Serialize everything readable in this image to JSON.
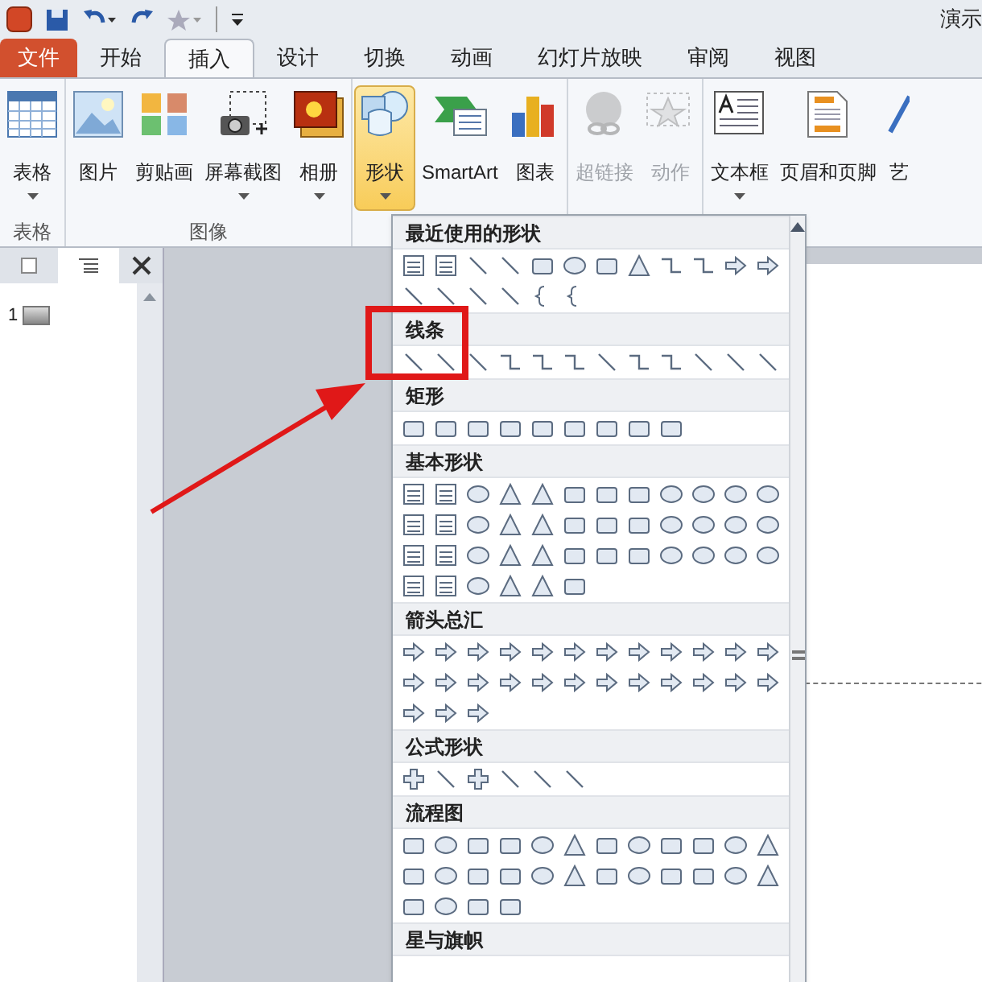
{
  "window": {
    "title": "演示"
  },
  "tabs": [
    {
      "label": "文件",
      "kind": "file",
      "selected": false
    },
    {
      "label": "开始",
      "kind": "tab",
      "selected": false
    },
    {
      "label": "插入",
      "kind": "tab",
      "selected": true
    },
    {
      "label": "设计",
      "kind": "tab",
      "selected": false
    },
    {
      "label": "切换",
      "kind": "tab",
      "selected": false
    },
    {
      "label": "动画",
      "kind": "tab",
      "selected": false
    },
    {
      "label": "幻灯片放映",
      "kind": "tab",
      "selected": false
    },
    {
      "label": "审阅",
      "kind": "tab",
      "selected": false
    },
    {
      "label": "视图",
      "kind": "tab",
      "selected": false
    }
  ],
  "ribbon_groups": [
    {
      "label": "表格",
      "buttons": [
        {
          "label": "表格",
          "dropdown": true,
          "disabled": false,
          "selected": false
        }
      ]
    },
    {
      "label": "图像",
      "buttons": [
        {
          "label": "图片",
          "dropdown": false,
          "disabled": false,
          "selected": false
        },
        {
          "label": "剪贴画",
          "dropdown": false,
          "disabled": false,
          "selected": false
        },
        {
          "label": "屏幕截图",
          "dropdown": true,
          "disabled": false,
          "selected": false
        },
        {
          "label": "相册",
          "dropdown": true,
          "disabled": false,
          "selected": false
        }
      ]
    },
    {
      "buttons": [
        {
          "label": "形状",
          "dropdown": true,
          "disabled": false,
          "selected": true
        },
        {
          "label": "SmartArt",
          "dropdown": false,
          "disabled": false,
          "selected": false
        },
        {
          "label": "图表",
          "dropdown": false,
          "disabled": false,
          "selected": false
        }
      ]
    },
    {
      "buttons": [
        {
          "label": "超链接",
          "dropdown": false,
          "disabled": true,
          "selected": false
        },
        {
          "label": "动作",
          "dropdown": false,
          "disabled": true,
          "selected": false
        }
      ]
    },
    {
      "buttons": [
        {
          "label": "文本框",
          "dropdown": true,
          "disabled": false,
          "selected": false
        },
        {
          "label": "页眉和页脚",
          "dropdown": false,
          "disabled": false,
          "selected": false
        },
        {
          "label": "艺",
          "dropdown": false,
          "disabled": false,
          "selected": false
        }
      ]
    }
  ],
  "slide_pane": {
    "slides": [
      {
        "number": "1"
      }
    ]
  },
  "shapes_menu": {
    "sections": [
      {
        "title": "最近使用的形状"
      },
      {
        "title": "线条"
      },
      {
        "title": "矩形"
      },
      {
        "title": "基本形状"
      },
      {
        "title": "箭头总汇"
      },
      {
        "title": "公式形状"
      },
      {
        "title": "流程图"
      },
      {
        "title": "星与旗帜"
      }
    ]
  }
}
